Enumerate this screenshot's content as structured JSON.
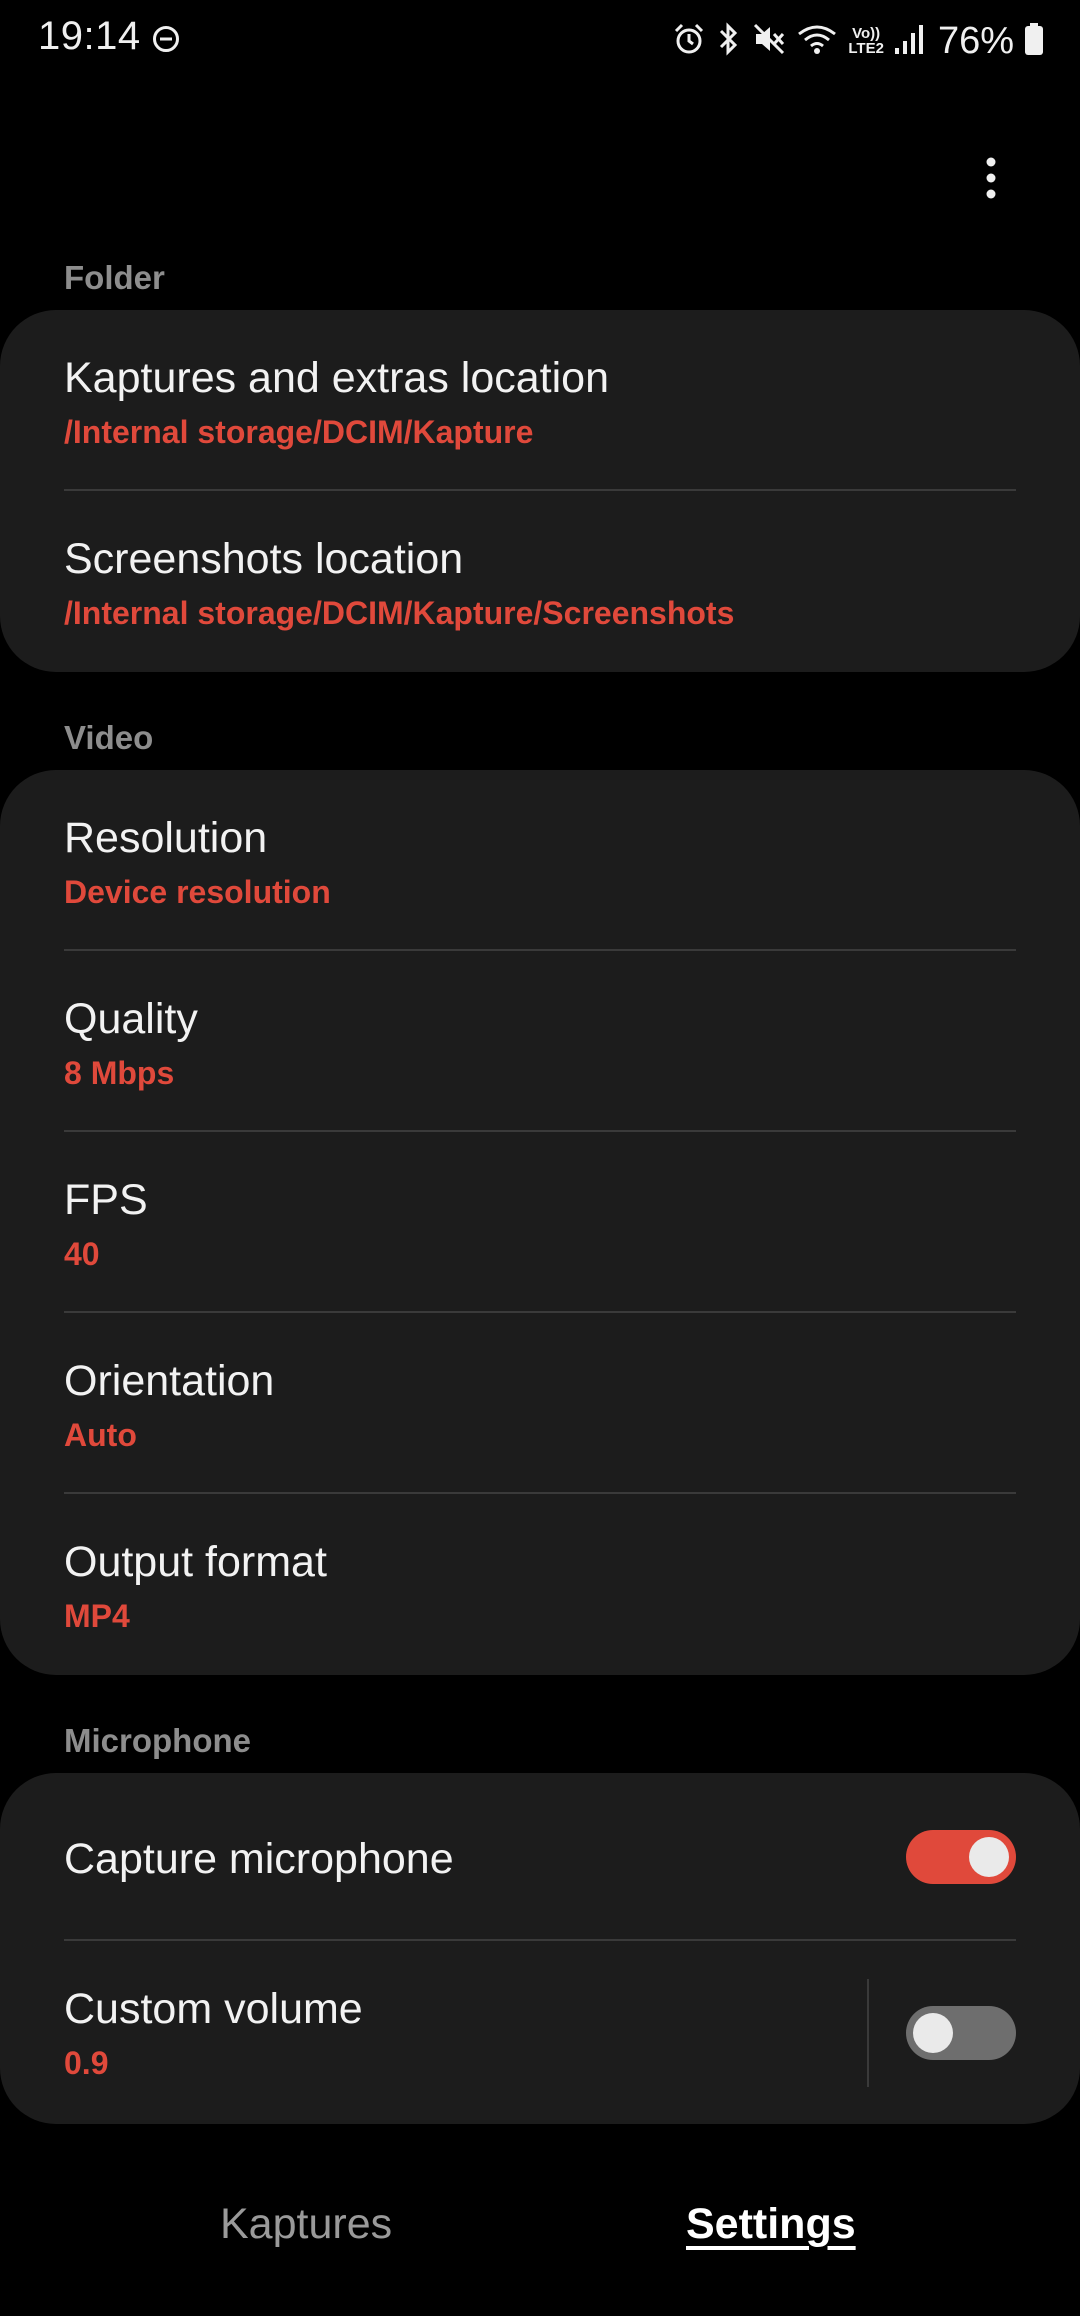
{
  "status_bar": {
    "time": "19:14",
    "battery": "76%",
    "icons": [
      "dnd-icon",
      "alarm-icon",
      "bluetooth-icon",
      "mute-icon",
      "wifi-icon",
      "volte-icon",
      "signal-icon",
      "battery-icon"
    ],
    "volte_line1": "Vo))",
    "volte_line2": "LTE2"
  },
  "menu": {
    "icon": "more-vert-icon"
  },
  "sections": {
    "folder": {
      "header": "Folder",
      "items": [
        {
          "title": "Kaptures and extras location",
          "value": "/Internal storage/DCIM/Kapture"
        },
        {
          "title": "Screenshots location",
          "value": "/Internal storage/DCIM/Kapture/Screenshots"
        }
      ]
    },
    "video": {
      "header": "Video",
      "items": [
        {
          "title": "Resolution",
          "value": "Device resolution"
        },
        {
          "title": "Quality",
          "value": "8 Mbps"
        },
        {
          "title": "FPS",
          "value": "40"
        },
        {
          "title": "Orientation",
          "value": "Auto"
        },
        {
          "title": "Output format",
          "value": "MP4"
        }
      ]
    },
    "microphone": {
      "header": "Microphone",
      "items": [
        {
          "title": "Capture microphone",
          "toggle_on": true
        },
        {
          "title": "Custom volume",
          "value": "0.9",
          "toggle_on": false
        }
      ]
    }
  },
  "bottom_nav": {
    "tabs": [
      {
        "label": "Kaptures",
        "active": false
      },
      {
        "label": "Settings",
        "active": true
      }
    ]
  },
  "colors": {
    "background": "#000000",
    "card": "#1c1c1c",
    "accent": "#e0493b",
    "section_header": "#8d8d8d",
    "divider": "#3a3a3a"
  }
}
